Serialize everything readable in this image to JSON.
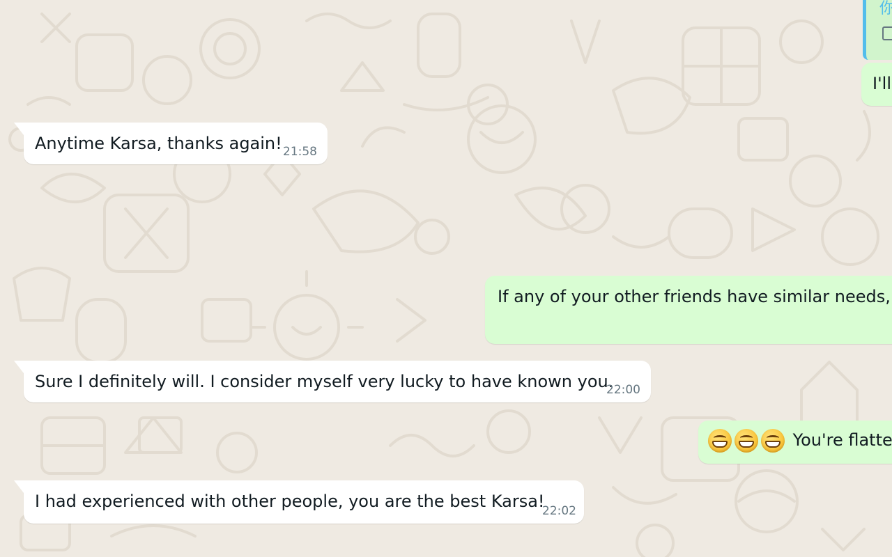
{
  "messages": [
    {
      "text": "Anytime Karsa, thanks again!",
      "time": "21:58"
    },
    {
      "text": "If any of your other friends have similar needs, I"
    },
    {
      "text": "Sure I definitely will. I consider myself very lucky to have known you.",
      "time": "22:00"
    },
    {
      "text": "You're flatte",
      "emoji": "grinning-face-with-big-eyes"
    },
    {
      "text": "I had experienced with other people, you are the best Karsa!",
      "time": "22:02"
    }
  ],
  "top_right": {
    "quoted_author_fragment": "你",
    "partial_text": "I'll"
  },
  "colors": {
    "background": "#efeae2",
    "incoming_bubble": "#ffffff",
    "outgoing_bubble": "#d9fdd3",
    "timestamp": "#667781",
    "quote_bar": "#53bdeb"
  }
}
